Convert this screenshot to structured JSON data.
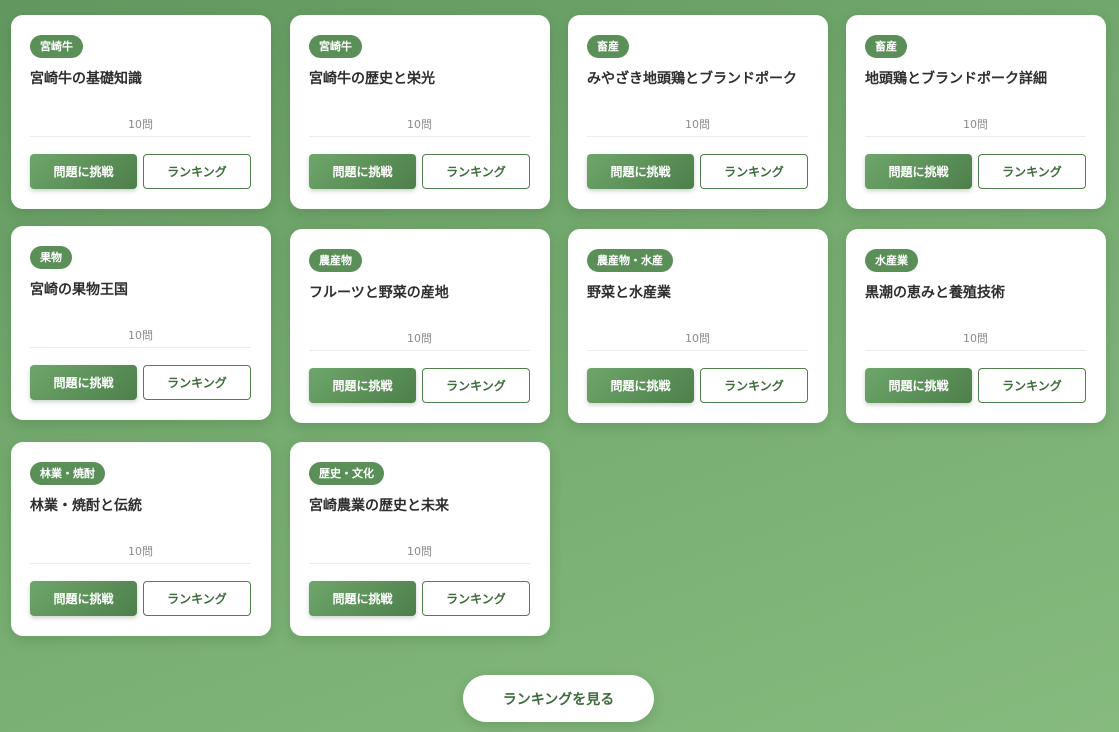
{
  "cards": [
    {
      "tag": "宮崎牛",
      "title": "宮崎牛の基礎知識",
      "count": "10問",
      "challenge": "問題に挑戦",
      "ranking": "ランキング"
    },
    {
      "tag": "宮崎牛",
      "title": "宮崎牛の歴史と栄光",
      "count": "10問",
      "challenge": "問題に挑戦",
      "ranking": "ランキング"
    },
    {
      "tag": "畜産",
      "title": "みやざき地頭鶏とブランドポーク",
      "count": "10問",
      "challenge": "問題に挑戦",
      "ranking": "ランキング"
    },
    {
      "tag": "畜産",
      "title": "地頭鶏とブランドポーク詳細",
      "count": "10問",
      "challenge": "問題に挑戦",
      "ranking": "ランキング"
    },
    {
      "tag": "果物",
      "title": "宮崎の果物王国",
      "count": "10問",
      "challenge": "問題に挑戦",
      "ranking": "ランキング"
    },
    {
      "tag": "農産物",
      "title": "フルーツと野菜の産地",
      "count": "10問",
      "challenge": "問題に挑戦",
      "ranking": "ランキング"
    },
    {
      "tag": "農産物・水産",
      "title": "野菜と水産業",
      "count": "10問",
      "challenge": "問題に挑戦",
      "ranking": "ランキング"
    },
    {
      "tag": "水産業",
      "title": "黒潮の恵みと養殖技術",
      "count": "10問",
      "challenge": "問題に挑戦",
      "ranking": "ランキング"
    },
    {
      "tag": "林業・焼酎",
      "title": "林業・焼酎と伝統",
      "count": "10問",
      "challenge": "問題に挑戦",
      "ranking": "ランキング"
    },
    {
      "tag": "歴史・文化",
      "title": "宮崎農業の歴史と未来",
      "count": "10問",
      "challenge": "問題に挑戦",
      "ranking": "ランキング"
    }
  ],
  "footer": {
    "see_ranking_label": "ランキングを見る"
  },
  "colors": {
    "accent": "#5a8f57",
    "button_text": "#3d6b3b",
    "background": "#75ab6f"
  }
}
